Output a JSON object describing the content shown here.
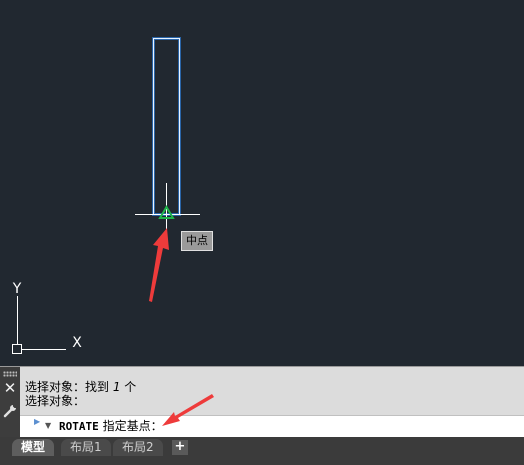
{
  "canvas": {
    "ucs_y_label": "Y",
    "ucs_x_label": "X",
    "snap_tooltip": "中点"
  },
  "command_line": {
    "history": [
      {
        "prefix": "选择对象：找到 ",
        "count": "1",
        "suffix": " 个"
      },
      {
        "text": "选择对象："
      }
    ],
    "command_name": "ROTATE",
    "prompt": " 指定基点："
  },
  "layout_tabs": {
    "items": [
      {
        "label": "模型",
        "active": true
      },
      {
        "label": "布局1",
        "active": false
      },
      {
        "label": "布局2",
        "active": false
      }
    ],
    "add_label": "+"
  },
  "colors": {
    "canvas_bg": "#212830",
    "selection_outline": "#cfe6ff",
    "selection_glow": "#2f7fdc",
    "snap_marker": "#1fb54b",
    "annotation_arrow": "#ee3b3b"
  }
}
